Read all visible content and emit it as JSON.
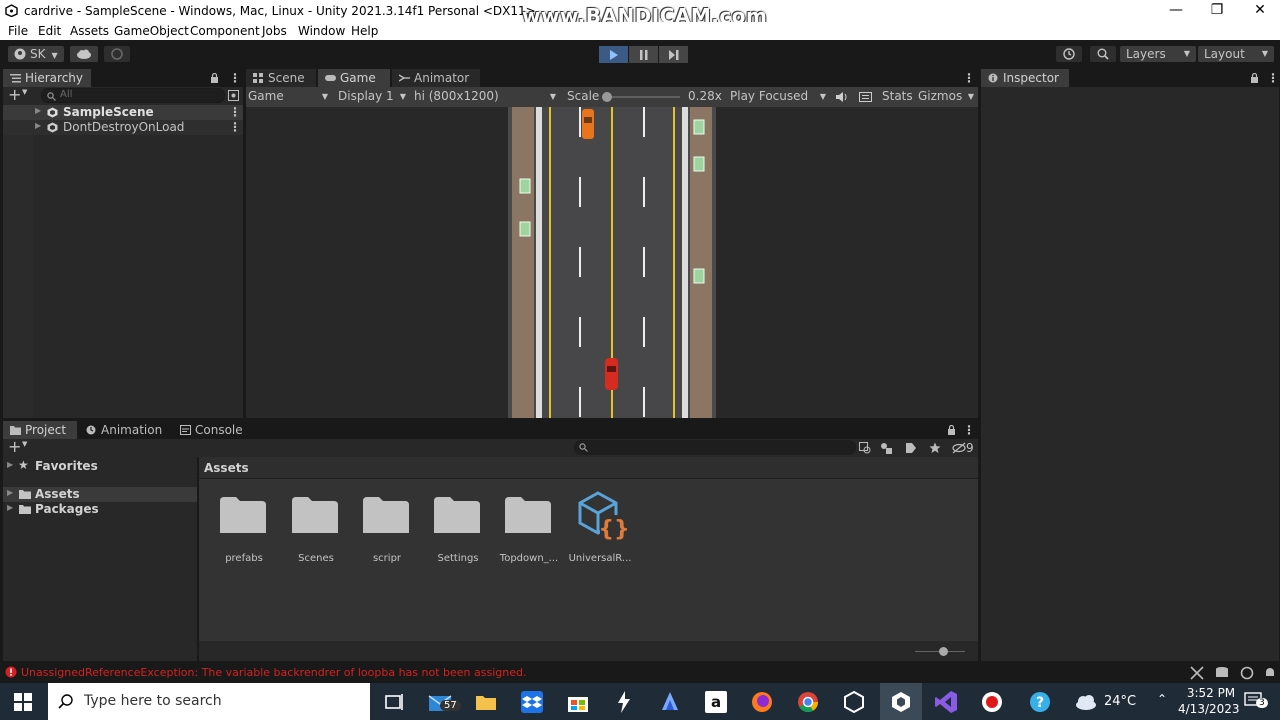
{
  "window": {
    "title": "cardrive - SampleScene - Windows, Mac, Linux - Unity 2021.3.14f1 Personal <DX11>",
    "watermark": "www.BANDICAM.com"
  },
  "menu": [
    "File",
    "Edit",
    "Assets",
    "GameObject",
    "Component",
    "Jobs",
    "Window",
    "Help"
  ],
  "toolbar": {
    "account": "SK",
    "layers": "Layers",
    "layout": "Layout"
  },
  "hierarchy": {
    "tab": "Hierarchy",
    "search_placeholder": "All",
    "items": [
      "SampleScene",
      "DontDestroyOnLoad"
    ]
  },
  "game_panel": {
    "tabs": [
      "Scene",
      "Game",
      "Animator"
    ],
    "view": "Game",
    "display": "Display 1",
    "resolution": "hi (800x1200)",
    "scale_label": "Scale",
    "scale_value": "0.28x",
    "play_mode": "Play Focused",
    "stats": "Stats",
    "gizmos": "Gizmos"
  },
  "inspector": {
    "tab": "Inspector"
  },
  "project": {
    "tabs": [
      "Project",
      "Animation",
      "Console"
    ],
    "hidden_count": "9",
    "tree": {
      "favorites": "Favorites",
      "assets": "Assets",
      "packages": "Packages"
    },
    "breadcrumb": "Assets",
    "items": [
      {
        "label": "prefabs",
        "icon": "folder-icon"
      },
      {
        "label": "Scenes",
        "icon": "folder-icon"
      },
      {
        "label": "scripr",
        "icon": "folder-icon"
      },
      {
        "label": "Settings",
        "icon": "folder-icon"
      },
      {
        "label": "Topdown_...",
        "icon": "folder-icon"
      },
      {
        "label": "UniversalR...",
        "icon": "urp-asset-icon"
      }
    ]
  },
  "status": {
    "error": "UnassignedReferenceException: The variable backrendrer of loopba has not been assigned.",
    "error_color": "#d32222"
  },
  "taskbar": {
    "search_placeholder": "Type here to search",
    "mail_badge": "57",
    "weather": "24°C",
    "time": "3:52 PM",
    "date": "4/13/2023",
    "notifications": "3"
  },
  "colors": {
    "accent": "#3a79bb",
    "play_active": "#3b5b85"
  }
}
